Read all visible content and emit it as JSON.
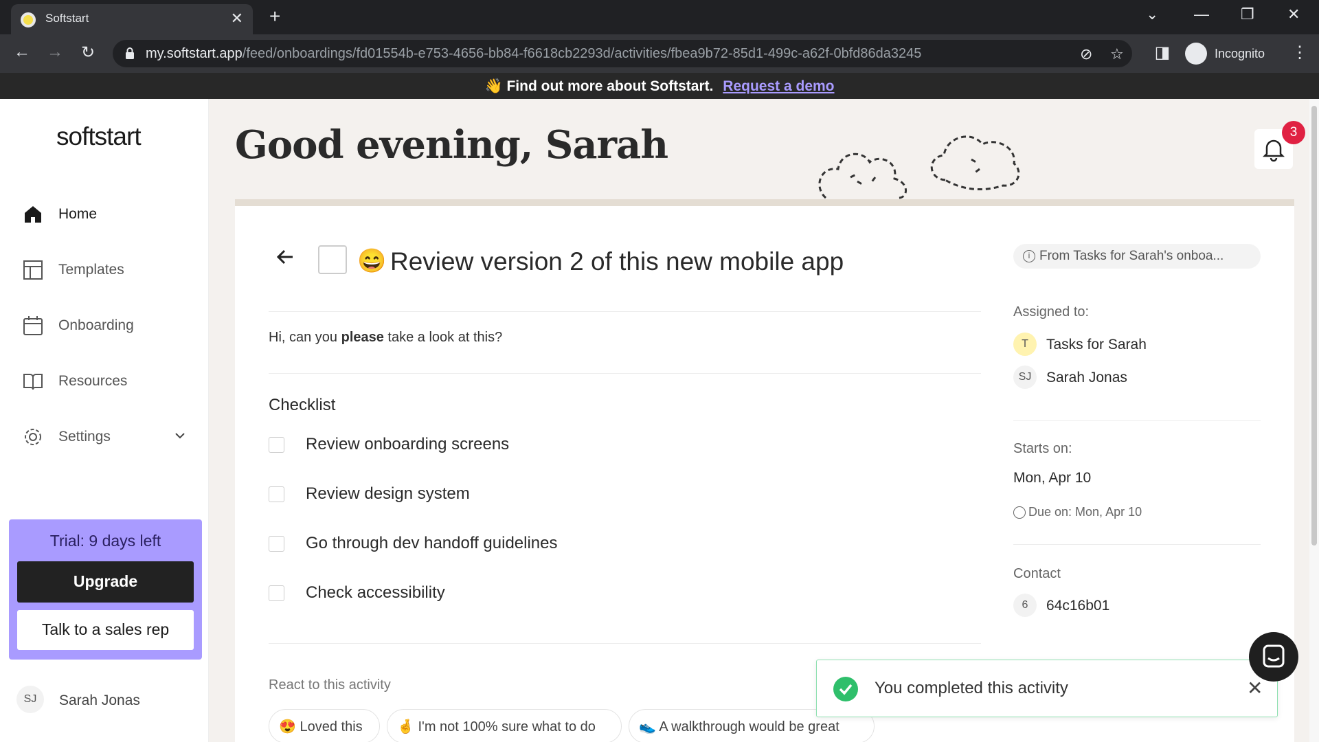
{
  "browser": {
    "tab_title": "Softstart",
    "url_host": "my.softstart.app",
    "url_path": "/feed/onboardings/fd01554b-e753-4656-bb84-f6618cb2293d/activities/fbea9b72-85d1-499c-a62f-0bfd86da3245",
    "profile_label": "Incognito"
  },
  "banner": {
    "emoji": "👋",
    "text": "Find out more about Softstart.",
    "link": "Request a demo"
  },
  "sidebar": {
    "logo": "softstart",
    "items": [
      {
        "label": "Home",
        "icon": "home-icon",
        "active": true
      },
      {
        "label": "Templates",
        "icon": "templates-icon"
      },
      {
        "label": "Onboarding",
        "icon": "calendar-icon"
      },
      {
        "label": "Resources",
        "icon": "book-icon"
      },
      {
        "label": "Settings",
        "icon": "gear-icon"
      }
    ],
    "trial": {
      "text": "Trial: 9 days left",
      "upgrade": "Upgrade",
      "sales": "Talk to a sales rep",
      "accent": "#a99bff"
    },
    "user": {
      "initials": "SJ",
      "name": "Sarah Jonas"
    }
  },
  "header": {
    "greeting": "Good evening, Sarah",
    "notification_count": "3"
  },
  "activity": {
    "emoji": "😄",
    "title": "Review version 2 of this new mobile app",
    "source": "From Tasks for Sarah's onboa...",
    "description_pre": "Hi, can you ",
    "description_bold": "please",
    "description_post": " take a look at this?",
    "checklist_title": "Checklist",
    "checklist": [
      "Review onboarding screens",
      "Review design system",
      "Go through dev handoff guidelines",
      "Check accessibility"
    ],
    "react_label": "React to this activity",
    "reactions": [
      {
        "emoji": "😍",
        "label": "Loved this"
      },
      {
        "emoji": "🤞",
        "label": "I'm not 100% sure what to do"
      },
      {
        "emoji": "👟",
        "label": "A walkthrough would be great"
      }
    ]
  },
  "details": {
    "assigned_label": "Assigned to:",
    "assignees": [
      {
        "initials": "T",
        "name": "Tasks for Sarah",
        "color": "#fff3b0"
      },
      {
        "initials": "SJ",
        "name": "Sarah Jonas",
        "color": "#f2f2f2"
      }
    ],
    "starts_label": "Starts on:",
    "starts_value": "Mon, Apr 10",
    "due": "Due on: Mon, Apr 10",
    "contact_label": "Contact",
    "contact": {
      "initials": "6",
      "name": "64c16b01"
    }
  },
  "toast": {
    "text": "You completed this activity",
    "color": "#2fbf6b"
  }
}
